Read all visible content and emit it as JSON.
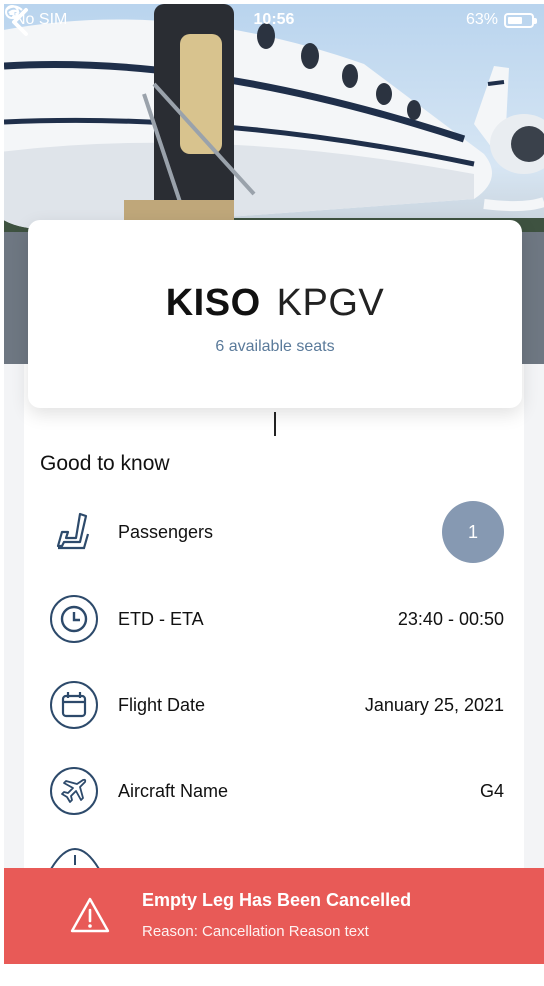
{
  "status_bar": {
    "carrier": "No SIM",
    "time": "10:56",
    "battery_text": "63%",
    "battery_level": 0.63,
    "wifi_icon": "wifi-icon",
    "rotation_lock_icon": "rotation-lock-icon"
  },
  "nav": {
    "back_icon": "chevron-left-icon"
  },
  "route": {
    "from": "KISO",
    "to": "KPGV",
    "seats_text": "6 available seats"
  },
  "details": {
    "title": "Good to know",
    "rows": [
      {
        "icon": "seat-icon",
        "label": "Passengers",
        "value": "1"
      },
      {
        "icon": "clock-icon",
        "label": "ETD - ETA",
        "value": "23:40 - 00:50"
      },
      {
        "icon": "calendar-icon",
        "label": "Flight Date",
        "value": "January 25, 2021"
      },
      {
        "icon": "airplane-icon",
        "label": "Aircraft Name",
        "value": "G4"
      }
    ]
  },
  "alert": {
    "icon": "warning-icon",
    "title": "Empty Leg Has Been Cancelled",
    "reason": "Reason: Cancellation Reason text"
  },
  "colors": {
    "alert_bg": "#e85a57",
    "badge_bg": "#8699b2",
    "icon_stroke": "#2d4a6b",
    "seats_text": "#5a7a9a"
  }
}
